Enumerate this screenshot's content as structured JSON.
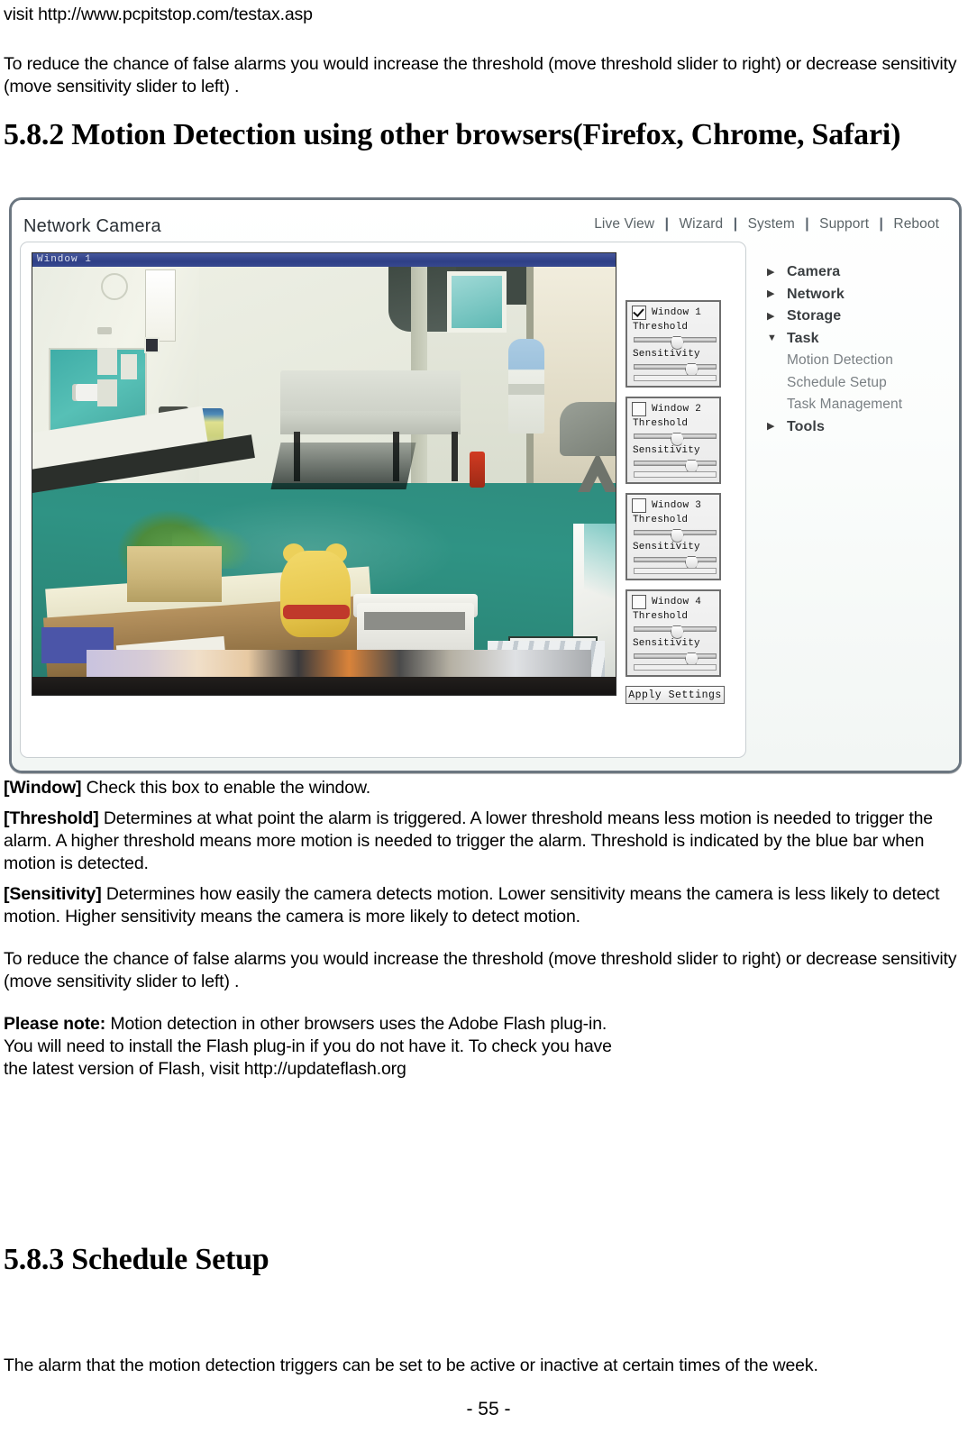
{
  "document": {
    "intro_line": "visit http://www.pcpitstop.com/testax.asp",
    "para_reduce_1": "To reduce the chance of false alarms you would increase the threshold (move threshold slider to right) or decrease sensitivity (move sensitivity slider to left) .",
    "heading_582": "5.8.2 Motion Detection using other browsers(Firefox, Chrome, Safari)",
    "def_window_term": "[Window]",
    "def_window_text": " Check this box to enable the window.",
    "def_threshold_term": "[Threshold]",
    "def_threshold_text": " Determines at what point the alarm is triggered. A lower threshold means less motion is needed to trigger the alarm. A higher threshold means more motion is needed to trigger the alarm. Threshold is indicated by the blue bar when motion is detected.",
    "def_sensitivity_term": "[Sensitivity]",
    "def_sensitivity_text": " Determines how easily the camera detects motion. Lower sensitivity means the camera is less likely to detect motion. Higher sensitivity means the camera is more likely to detect motion.",
    "para_reduce_2": "To reduce the chance of false alarms you would increase the threshold (move threshold slider to right) or decrease sensitivity (move sensitivity slider to left) .",
    "note_term": "Please note:",
    "note_text": " Motion detection in other browsers uses the Adobe Flash plug-in. You will need to install the Flash plug-in if you do not have it. To check you have the latest version of Flash, visit http://updateflash.org",
    "heading_583": "5.8.3 Schedule Setup",
    "para_schedule": "The alarm that the motion detection triggers can be set to be active or inactive at certain times of the week.",
    "page_number": "- 55 -"
  },
  "screenshot": {
    "brand": "Network Camera",
    "topnav": {
      "separator": "|",
      "items": [
        "Live View",
        "Wizard",
        "System",
        "Support",
        "Reboot"
      ]
    },
    "video": {
      "overlay_label": "Window 1"
    },
    "panels": [
      {
        "checkbox_checked": true,
        "title": "Window 1",
        "threshold_label": "Threshold",
        "threshold_value": 50,
        "sensitivity_label": "Sensitivity",
        "sensitivity_value": 66,
        "bar_value": 0
      },
      {
        "checkbox_checked": false,
        "title": "Window 2",
        "threshold_label": "Threshold",
        "threshold_value": 50,
        "sensitivity_label": "Sensitivity",
        "sensitivity_value": 66,
        "bar_value": 0
      },
      {
        "checkbox_checked": false,
        "title": "Window 3",
        "threshold_label": "Threshold",
        "threshold_value": 50,
        "sensitivity_label": "Sensitivity",
        "sensitivity_value": 66,
        "bar_value": 0
      },
      {
        "checkbox_checked": false,
        "title": "Window 4",
        "threshold_label": "Threshold",
        "threshold_value": 50,
        "sensitivity_label": "Sensitivity",
        "sensitivity_value": 66,
        "bar_value": 0
      }
    ],
    "apply_button": "Apply Settings",
    "menu": [
      {
        "label": "Camera",
        "level": "top",
        "state": "collapsed",
        "icon": "triangle-right-icon"
      },
      {
        "label": "Network",
        "level": "top",
        "state": "collapsed",
        "icon": "triangle-right-icon"
      },
      {
        "label": "Storage",
        "level": "top",
        "state": "collapsed",
        "icon": "triangle-right-icon"
      },
      {
        "label": "Task",
        "level": "top",
        "state": "expanded",
        "icon": "triangle-down-icon"
      },
      {
        "label": "Motion Detection",
        "level": "sub",
        "state": "",
        "icon": ""
      },
      {
        "label": "Schedule Setup",
        "level": "sub",
        "state": "",
        "icon": ""
      },
      {
        "label": "Task Management",
        "level": "sub",
        "state": "",
        "icon": ""
      },
      {
        "label": "Tools",
        "level": "top",
        "state": "collapsed",
        "icon": "triangle-right-icon"
      }
    ],
    "colors": {
      "frame_border": "#6b7680",
      "title_bar_blue": "#2e3f86",
      "floor_green": "#2f8d7f",
      "menu_top_text": "#3b3f42",
      "menu_sub_text": "#7a8084"
    }
  }
}
